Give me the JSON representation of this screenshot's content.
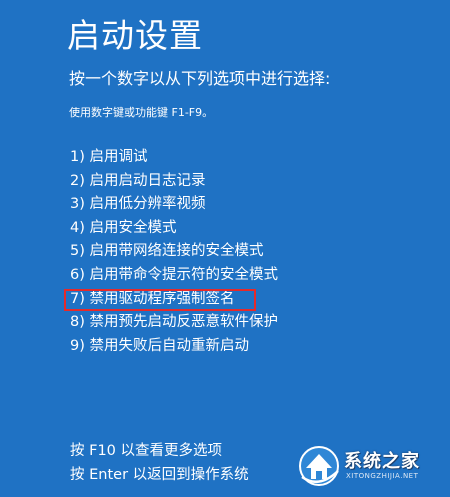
{
  "title": "启动设置",
  "subtitle": "按一个数字以从下列选项中进行选择:",
  "hint": "使用数字键或功能键 F1-F9。",
  "options": [
    {
      "label": "1) 启用调试",
      "highlighted": false
    },
    {
      "label": "2) 启用启动日志记录",
      "highlighted": false
    },
    {
      "label": "3) 启用低分辨率视频",
      "highlighted": false
    },
    {
      "label": "4) 启用安全模式",
      "highlighted": false
    },
    {
      "label": "5) 启用带网络连接的安全模式",
      "highlighted": false
    },
    {
      "label": "6) 启用带命令提示符的安全模式",
      "highlighted": false
    },
    {
      "label": "7) 禁用驱动程序强制签名",
      "highlighted": true
    },
    {
      "label": "8) 禁用预先启动反恶意软件保护",
      "highlighted": false
    },
    {
      "label": "9) 禁用失败后自动重新启动",
      "highlighted": false
    }
  ],
  "footer": {
    "more_options": "按 F10 以查看更多选项",
    "return_os": "按 Enter 以返回到操作系统"
  },
  "watermark": {
    "text": "系统之家",
    "url": "XITONGZHIJIA.NET",
    "icon": "house-logo-icon"
  },
  "colors": {
    "background": "#1f72c4",
    "text": "#ffffff",
    "highlight_border": "#e52a2a"
  }
}
